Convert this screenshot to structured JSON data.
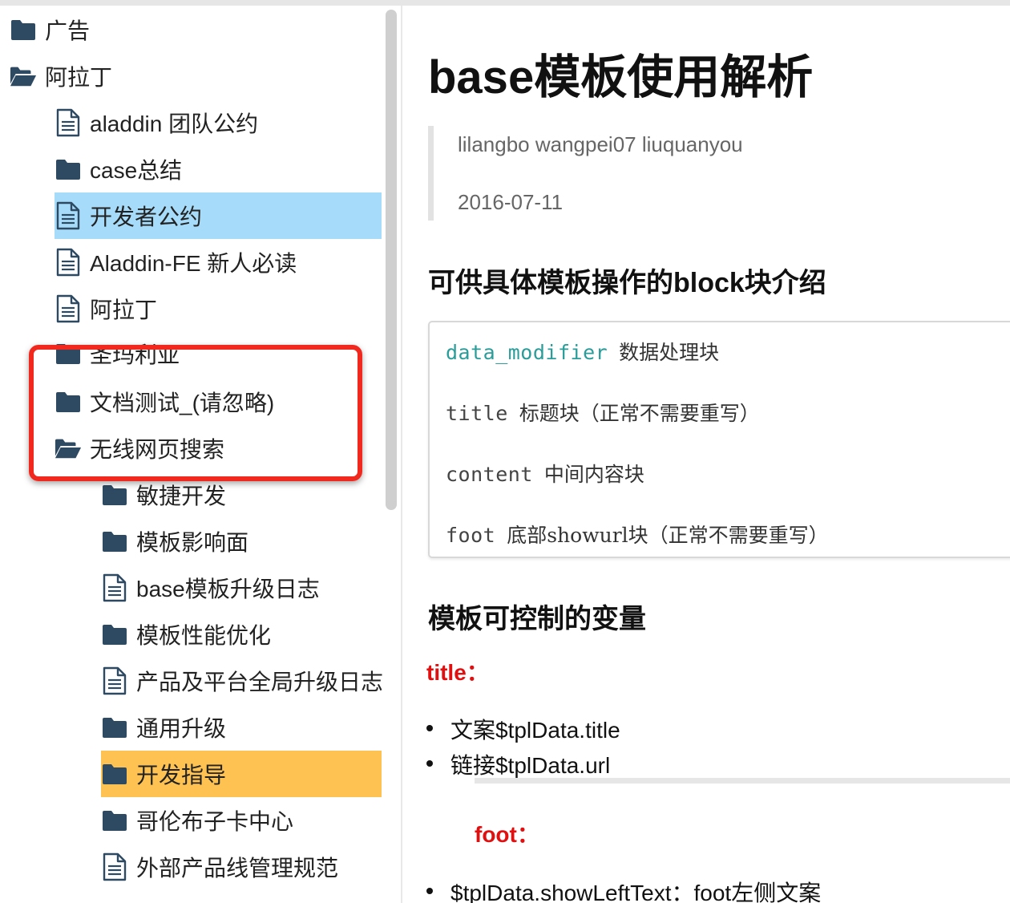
{
  "sidebar": {
    "items": [
      {
        "label": "广告",
        "icon": "folder-closed-icon"
      },
      {
        "label": "阿拉丁",
        "icon": "folder-open-icon"
      },
      {
        "label": "aladdin 团队公约",
        "icon": "document-icon"
      },
      {
        "label": "case总结",
        "icon": "folder-closed-icon"
      },
      {
        "label": "开发者公约",
        "icon": "document-icon",
        "selected": true
      },
      {
        "label": "Aladdin-FE 新人必读",
        "icon": "document-icon"
      },
      {
        "label": "阿拉丁",
        "icon": "document-icon"
      },
      {
        "label": "圣玛利亚",
        "icon": "folder-closed-icon"
      },
      {
        "label": "文档测试_(请忽略)",
        "icon": "folder-closed-icon"
      },
      {
        "label": "无线网页搜索",
        "icon": "folder-open-icon"
      },
      {
        "label": "敏捷开发",
        "icon": "folder-closed-icon"
      },
      {
        "label": "模板影响面",
        "icon": "folder-closed-icon"
      },
      {
        "label": "base模板升级日志",
        "icon": "document-icon"
      },
      {
        "label": "模板性能优化",
        "icon": "folder-closed-icon"
      },
      {
        "label": "产品及平台全局升级日志",
        "icon": "document-icon"
      },
      {
        "label": "通用升级",
        "icon": "folder-closed-icon"
      },
      {
        "label": "开发指导",
        "icon": "folder-closed-icon",
        "active": true
      },
      {
        "label": "哥伦布子卡中心",
        "icon": "folder-closed-icon"
      },
      {
        "label": "外部产品线管理规范",
        "icon": "document-icon"
      }
    ]
  },
  "colors": {
    "selected_blue": "#a6dcfa",
    "active_orange": "#fec252",
    "folder_icon": "#2e4a63",
    "highlight_red": "#f0281e",
    "code_teal": "#2a9d9a",
    "variable_red": "#e01010"
  },
  "content": {
    "title": "base模板使用解析",
    "authors": "lilangbo wangpei07 liuquanyou",
    "date": "2016-07-11",
    "section1": "可供具体模板操作的block块介绍",
    "blocks": [
      {
        "code": "data_modifier",
        "desc": "数据处理块"
      },
      {
        "code": "title",
        "desc": "标题块（正常不需要重写）"
      },
      {
        "code": "content",
        "desc": "中间内容块"
      },
      {
        "code": "foot",
        "desc": "底部showurl块（正常不需要重写）"
      }
    ],
    "section2": "模板可控制的变量",
    "var_title": "title：",
    "title_bullets": [
      "文案$tplData.title",
      "链接$tplData.url"
    ],
    "var_foot": "foot：",
    "foot_bullets": [
      "$tplData.showLeftText：foot左侧文案"
    ]
  }
}
